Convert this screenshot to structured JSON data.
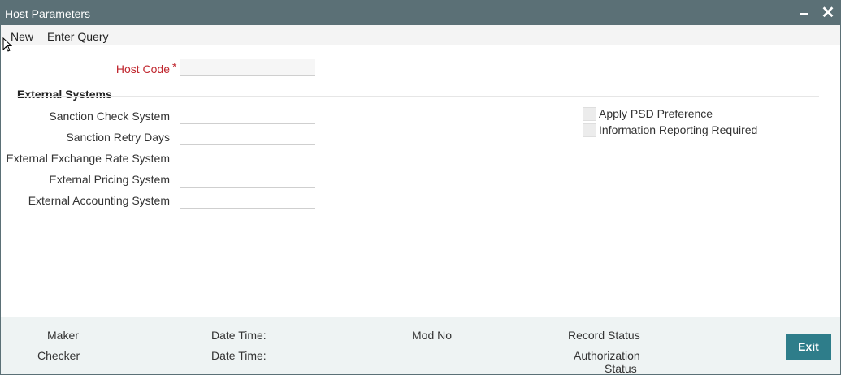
{
  "window": {
    "title": "Host Parameters"
  },
  "toolbar": {
    "new_label": "New",
    "enter_query_label": "Enter Query"
  },
  "host_code": {
    "label": "Host Code",
    "required_mark": "*",
    "value": ""
  },
  "external_systems": {
    "heading": "External Systems",
    "fields": [
      {
        "label": "Sanction Check System",
        "value": ""
      },
      {
        "label": "Sanction Retry Days",
        "value": ""
      },
      {
        "label": "External Exchange Rate System",
        "value": ""
      },
      {
        "label": "External Pricing System",
        "value": ""
      },
      {
        "label": "External Accounting System",
        "value": ""
      }
    ]
  },
  "options": [
    {
      "label": "Apply PSD Preference",
      "checked": false
    },
    {
      "label": "Information Reporting Required",
      "checked": false
    }
  ],
  "footer": {
    "maker_label": "Maker",
    "checker_label": "Checker",
    "date_time_label_1": "Date Time:",
    "date_time_label_2": "Date Time:",
    "mod_no_label": "Mod No",
    "record_status_label": "Record Status",
    "authorization_status_line1": "Authorization",
    "authorization_status_line2": "Status",
    "exit_label": "Exit"
  }
}
